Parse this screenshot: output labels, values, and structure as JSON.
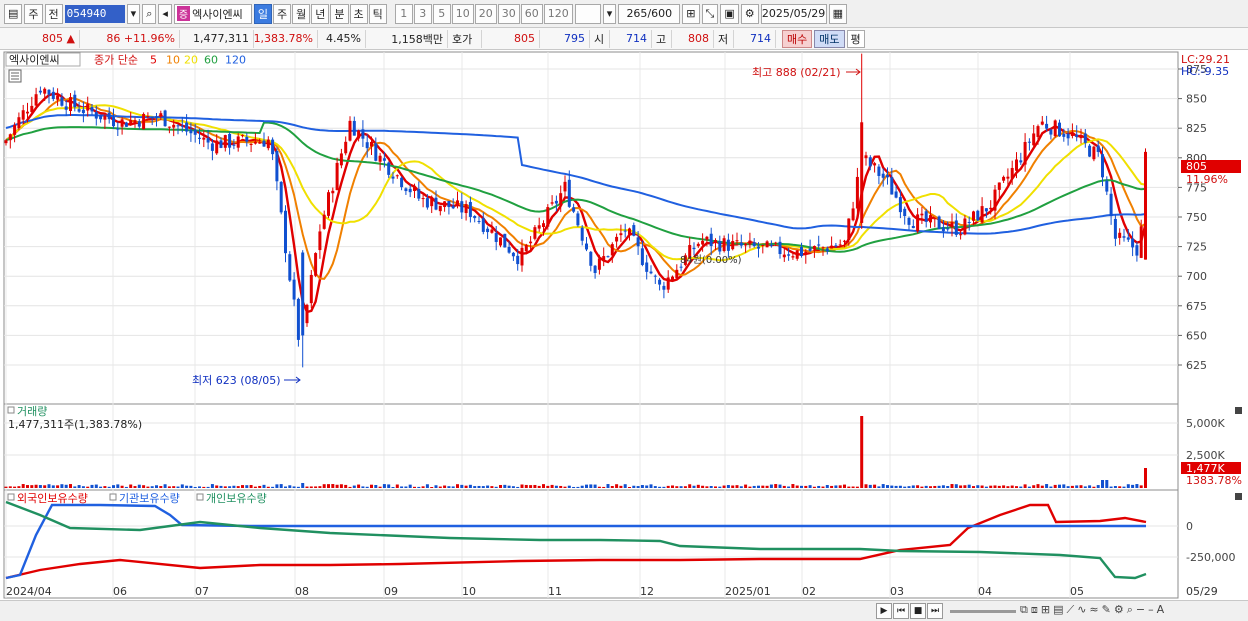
{
  "toolbar": {
    "mode1": "주",
    "mode2": "전",
    "code": "054940",
    "stock_badge": "증",
    "stock_name": "엑사이엔씨",
    "periods": [
      "일",
      "주",
      "월",
      "년",
      "분",
      "초",
      "틱"
    ],
    "selected_period": "일",
    "minutes": [
      "1",
      "3",
      "5",
      "10",
      "20",
      "30",
      "60",
      "120"
    ],
    "count": "265",
    "count_total": "/600",
    "date": "2025/05/29"
  },
  "quote": {
    "price": "805",
    "arrow": "▲",
    "change": "86",
    "pct": "+11.96%",
    "volume": "1,477,311",
    "vol_ratio": "1,383.78%",
    "turnover": "4.45%",
    "amount": "1,158백만",
    "hoga_label": "호가",
    "ask": "805",
    "bid": "795",
    "open_label": "시",
    "open": "714",
    "high_label": "고",
    "high": "808",
    "low_label": "저",
    "low": "714",
    "buy_label": "매수",
    "sell_label": "매도",
    "eval_label": "평"
  },
  "legend": {
    "name": "엑사이엔씨",
    "ma_label": "종가 단순",
    "ma": [
      {
        "p": "5",
        "color": "#e00000"
      },
      {
        "p": "10",
        "color": "#f08000"
      },
      {
        "p": "20",
        "color": "#f0e000"
      },
      {
        "p": "60",
        "color": "#20a040"
      },
      {
        "p": "120",
        "color": "#2060e0"
      }
    ]
  },
  "annotations": {
    "high": "최고 888 (02/21)",
    "low": "최저 623 (08/05)",
    "lc": "LC:29.21",
    "hc": "HC:-9.35",
    "price_tag": "805",
    "pct_tag": "11.96%",
    "middle_text": "84원(0.00%)"
  },
  "volume": {
    "title": "거래량",
    "value": "1,477,311주(1,383.78%)",
    "ticks": [
      "5,000K",
      "2,500K"
    ],
    "tag": "1,477K",
    "tag_pct": "1383.78%"
  },
  "holdings": {
    "labels": [
      "외국인보유수량",
      "기관보유수량",
      "개인보유수량"
    ],
    "colors": [
      "#e00000",
      "#2060e0",
      "#209060"
    ],
    "ticks": [
      "0",
      "-250,000"
    ]
  },
  "price_axis": [
    "875",
    "850",
    "825",
    "800",
    "775",
    "750",
    "725",
    "700",
    "675",
    "650",
    "625"
  ],
  "xaxis": [
    "2024/04",
    "06",
    "07",
    "08",
    "09",
    "10",
    "11",
    "12",
    "2025/01",
    "02",
    "03",
    "04",
    "05",
    "05/29"
  ],
  "chart_data": {
    "type": "candlestick",
    "ylim": [
      600,
      890
    ],
    "ma_series": [
      "5",
      "10",
      "20",
      "60",
      "120"
    ],
    "high": {
      "value": 888,
      "date": "02/21"
    },
    "low": {
      "value": 623,
      "date": "08/05"
    },
    "last": {
      "close": 805,
      "open": 714,
      "high": 808,
      "low": 714,
      "volume": 1477311
    }
  }
}
